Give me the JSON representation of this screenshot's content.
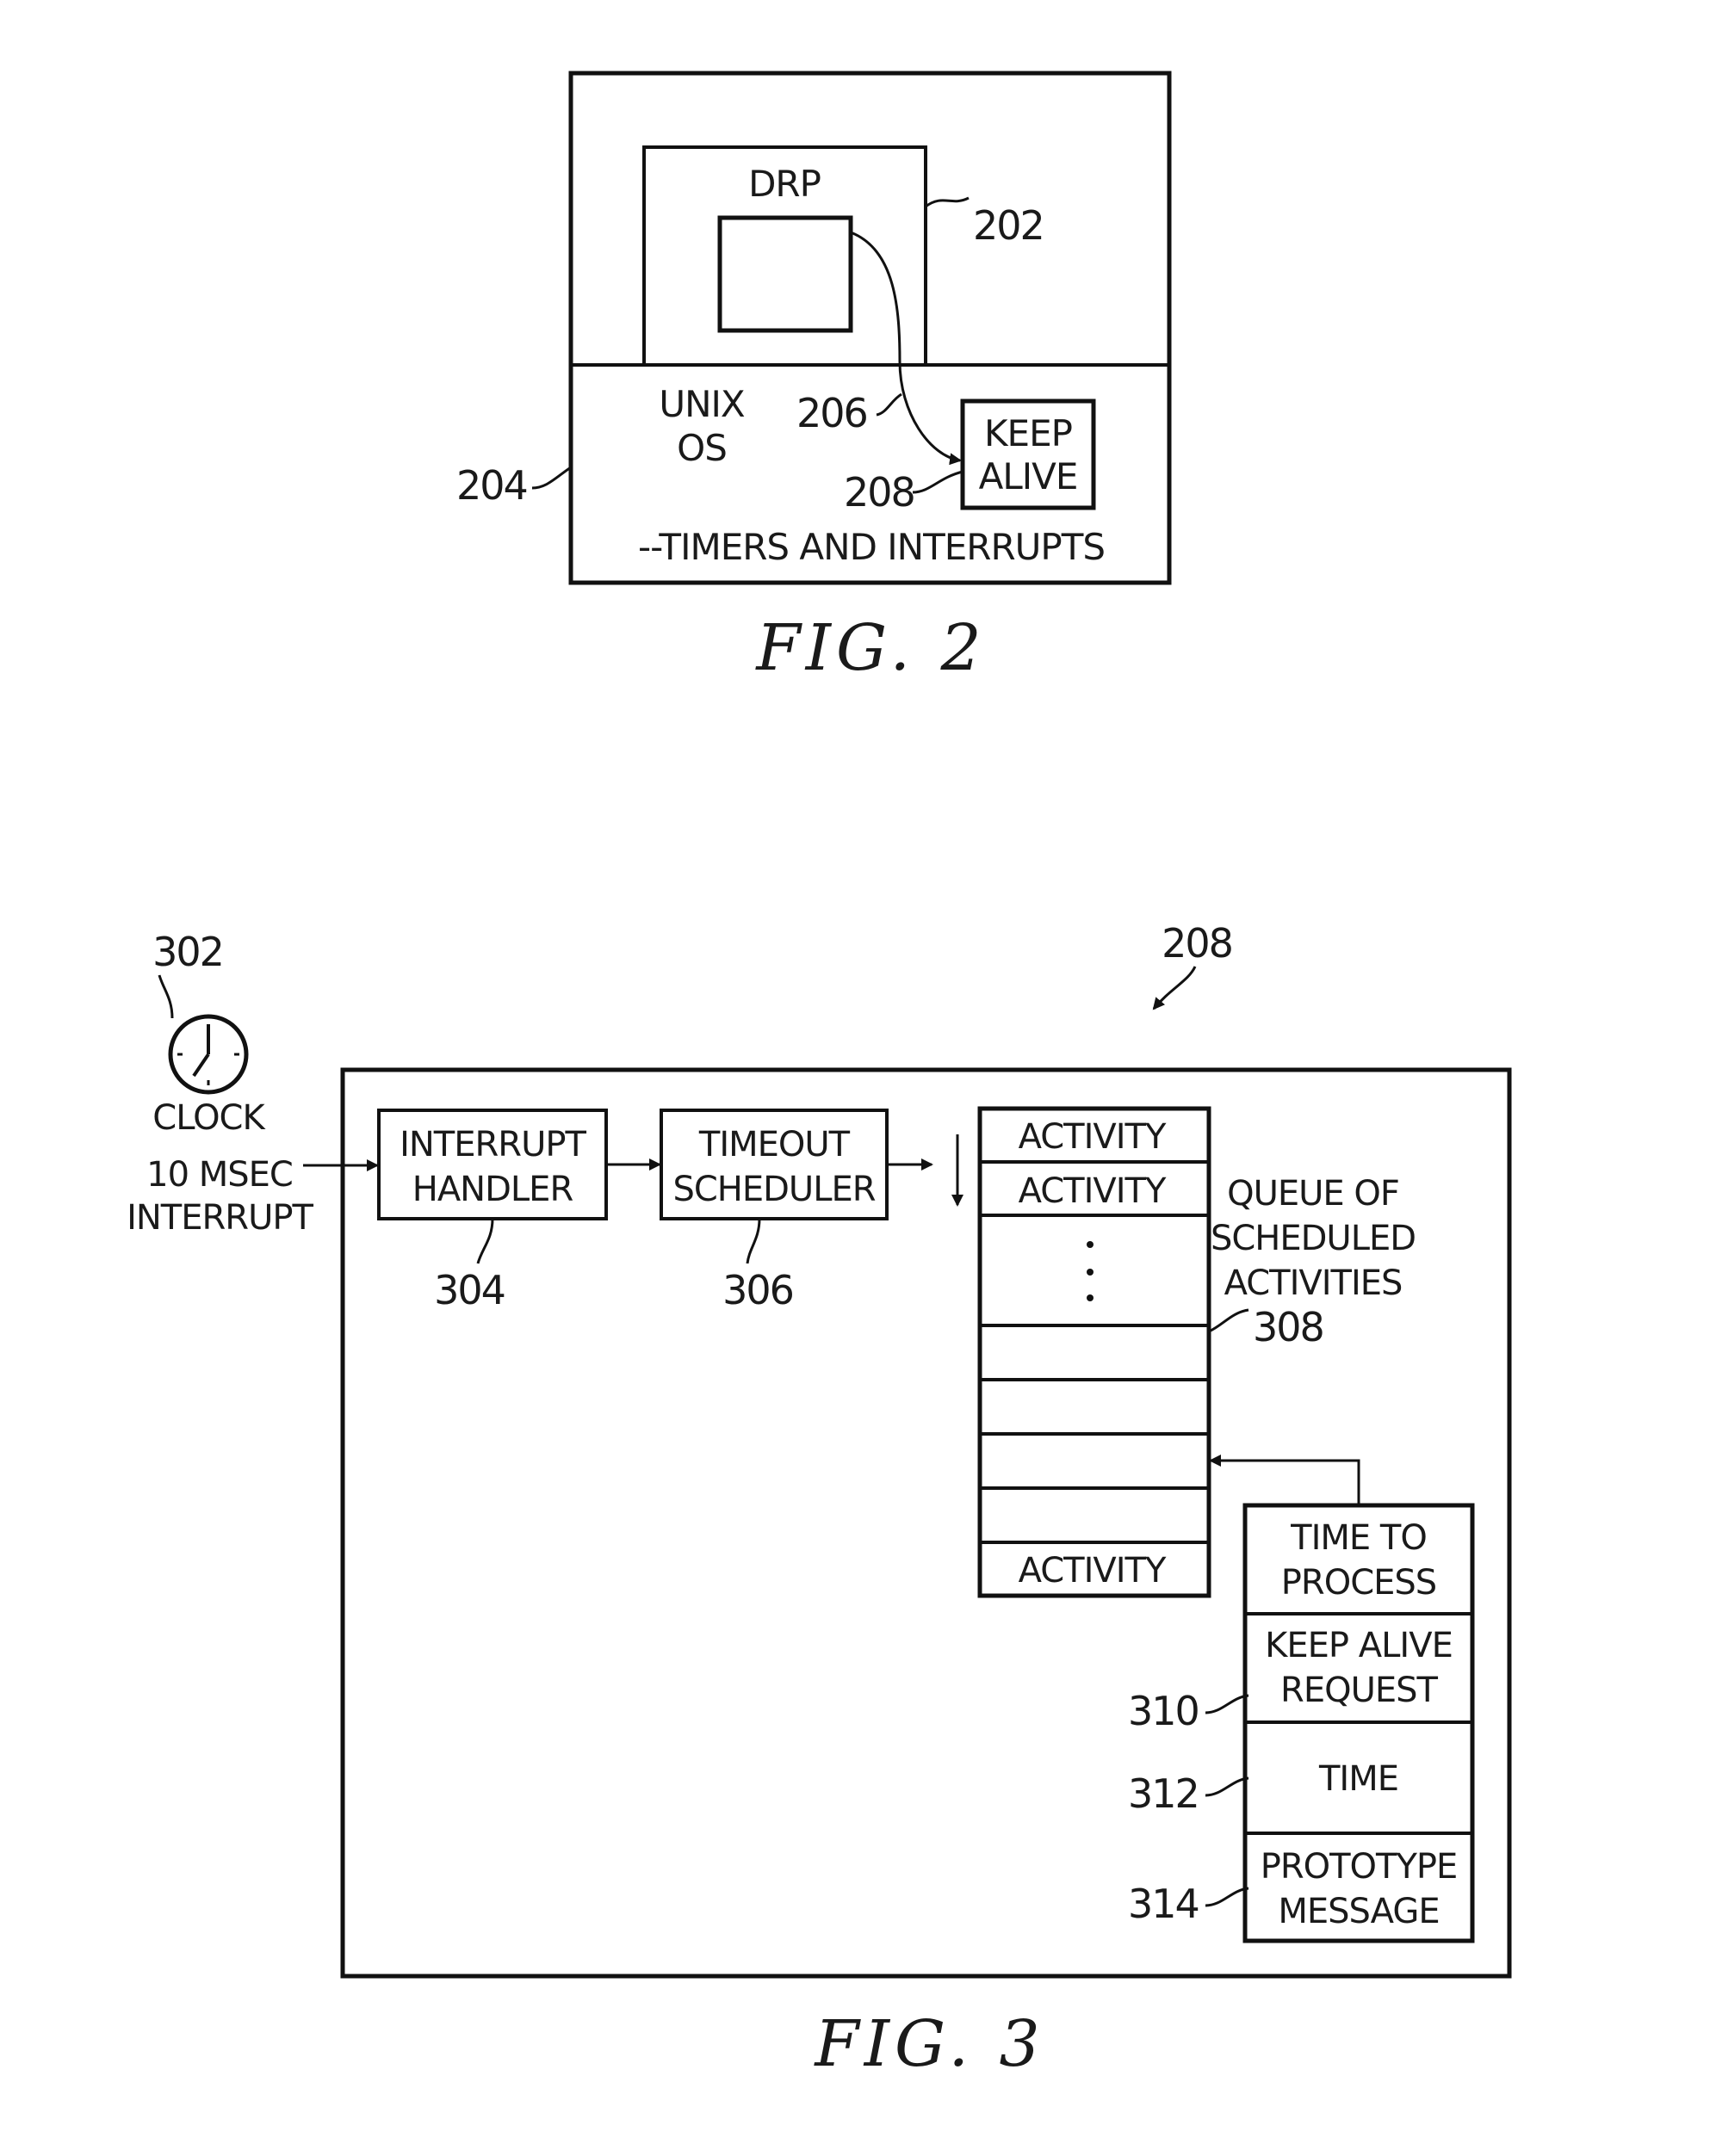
{
  "fig2": {
    "caption": "FIG. 2",
    "drp_label": "DRP",
    "os_label_line1": "UNIX",
    "os_label_line2": "OS",
    "keepalive_line1": "KEEP",
    "keepalive_line2": "ALIVE",
    "timers_label": "--TIMERS AND INTERRUPTS",
    "refs": {
      "drp": "202",
      "os": "204",
      "arrow": "206",
      "keepalive": "208"
    }
  },
  "fig3": {
    "caption": "FIG. 3",
    "ref_keepalive": "208",
    "clock": {
      "ref": "302",
      "label": "CLOCK",
      "interrupt_line1": "10 MSEC",
      "interrupt_line2": "INTERRUPT"
    },
    "interrupt_handler": {
      "line1": "INTERRUPT",
      "line2": "HANDLER",
      "ref": "304"
    },
    "timeout_scheduler": {
      "line1": "TIMEOUT",
      "line2": "SCHEDULER",
      "ref": "306"
    },
    "queue": {
      "label_line1": "QUEUE OF",
      "label_line2": "SCHEDULED",
      "label_line3": "ACTIVITIES",
      "ref": "308",
      "slots": [
        "ACTIVITY",
        "ACTIVITY",
        "",
        "",
        "",
        "",
        "",
        "ACTIVITY"
      ]
    },
    "request": {
      "rows": [
        {
          "line1": "TIME TO",
          "line2": "PROCESS",
          "ref": ""
        },
        {
          "line1": "KEEP ALIVE",
          "line2": "REQUEST",
          "ref": "310"
        },
        {
          "line1": "TIME",
          "line2": "",
          "ref": "312"
        },
        {
          "line1": "PROTOTYPE",
          "line2": "MESSAGE",
          "ref": "314"
        }
      ]
    }
  }
}
